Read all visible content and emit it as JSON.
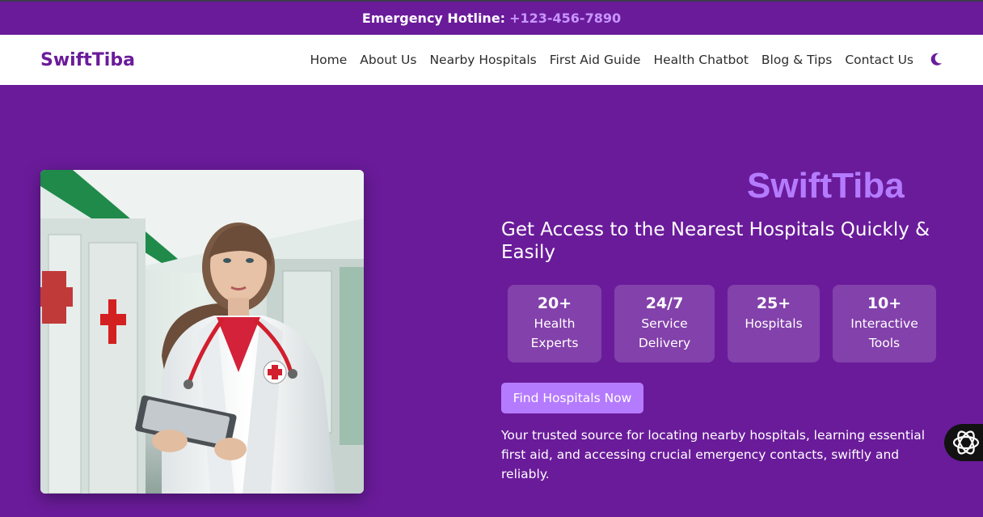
{
  "topbar": {
    "label": "Emergency Hotline:",
    "phone": "+123-456-7890"
  },
  "navbar": {
    "brand": "SwiftTiba",
    "links": [
      "Home",
      "About Us",
      "Nearby Hospitals",
      "First Aid Guide",
      "Health Chatbot",
      "Blog & Tips",
      "Contact Us"
    ],
    "theme_icon": "moon-icon"
  },
  "hero": {
    "title": "SwiftTiba",
    "subtitle": "Get Access to the Nearest Hospitals Quickly & Easily",
    "stats": [
      {
        "num": "20+",
        "line1": "Health",
        "line2": "Experts"
      },
      {
        "num": "24/7",
        "line1": "Service",
        "line2": "Delivery"
      },
      {
        "num": "25+",
        "line1": "Hospitals",
        "line2": ""
      },
      {
        "num": "10+",
        "line1": "Interactive",
        "line2": "Tools"
      }
    ],
    "cta": "Find Hospitals Now",
    "description": "Your trusted source for locating nearby hospitals, learning essential first aid, and accessing crucial emergency contacts, swiftly and reliably."
  },
  "colors": {
    "primary": "#6a1b9a",
    "accent": "#b57bff"
  },
  "chat_fab_icon": "openai-icon"
}
